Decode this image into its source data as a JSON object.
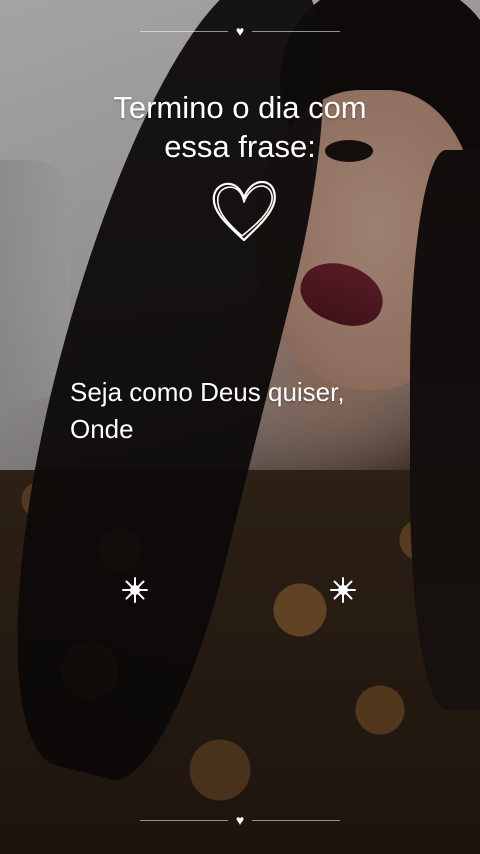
{
  "story": {
    "title_line1": "Termino o dia com",
    "title_line2": "essa frase:",
    "message_line1": "Seja como Deus quiser,",
    "message_line2": "Onde",
    "divider_glyph": "♥",
    "icons": {
      "top_divider": "heart-icon",
      "doodle": "hand-drawn-heart-icon",
      "sparkles": "sparkle-icon",
      "bottom_divider": "heart-icon"
    },
    "colors": {
      "text": "#ffffff"
    }
  }
}
